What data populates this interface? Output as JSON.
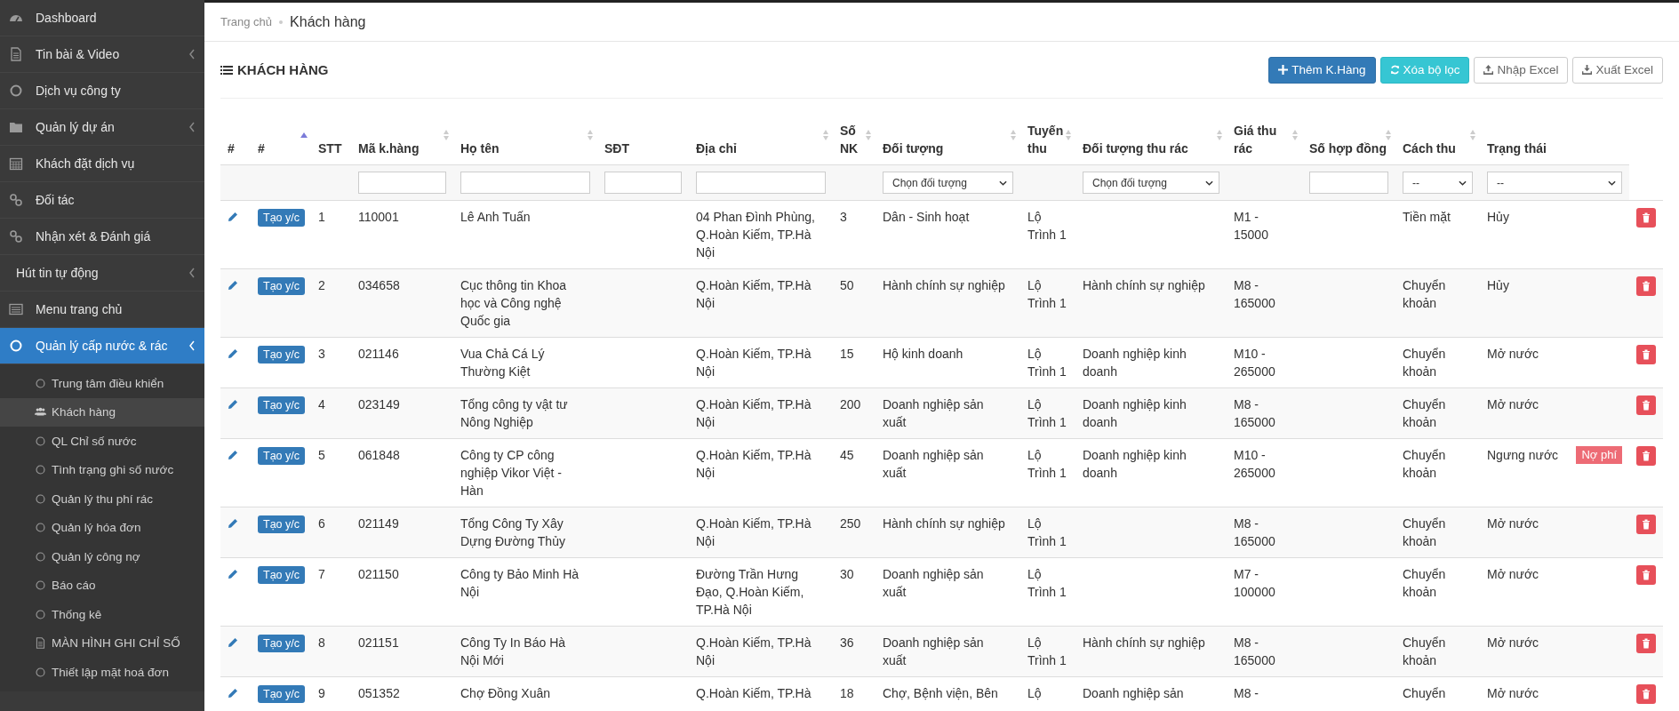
{
  "sidebar": {
    "items": [
      {
        "label": "Dashboard",
        "selected": false,
        "has_submenu": false
      },
      {
        "label": "Tin bài & Video",
        "selected": false,
        "has_submenu": true
      },
      {
        "label": "Dịch vụ công ty",
        "selected": false,
        "has_submenu": false
      },
      {
        "label": "Quản lý dự án",
        "selected": false,
        "has_submenu": true
      },
      {
        "label": "Khách đặt dịch vụ",
        "selected": false,
        "has_submenu": false
      },
      {
        "label": "Đối tác",
        "selected": false,
        "has_submenu": false
      },
      {
        "label": "Nhận xét & Đánh giá",
        "selected": false,
        "has_submenu": false
      },
      {
        "label": "Hút tin tự động",
        "selected": false,
        "has_submenu": true
      },
      {
        "label": "Menu trang chủ",
        "selected": false,
        "has_submenu": false
      },
      {
        "label": "Quản lý cấp nước & rác",
        "selected": true,
        "has_submenu": true,
        "children": [
          {
            "label": "Trung tâm điều khiển",
            "selected": false
          },
          {
            "label": "Khách hàng",
            "selected": true
          },
          {
            "label": "QL Chỉ số nước",
            "selected": false
          },
          {
            "label": "Tình trạng ghi số nước",
            "selected": false
          },
          {
            "label": "Quản lý thu phí rác",
            "selected": false
          },
          {
            "label": "Quản lý hóa đơn",
            "selected": false
          },
          {
            "label": "Quản lý công nợ",
            "selected": false
          },
          {
            "label": "Báo cáo",
            "selected": false
          },
          {
            "label": "Thống kê",
            "selected": false
          },
          {
            "label": "MÀN HÌNH GHI CHỈ SỐ",
            "selected": false
          },
          {
            "label": "Thiết lập mặt hoá đơn",
            "selected": false
          }
        ]
      }
    ]
  },
  "breadcrumb": [
    "Trang chủ",
    "Khách hàng"
  ],
  "panel": {
    "title": "KHÁCH HÀNG",
    "buttons": [
      {
        "label": "Thêm K.Hàng",
        "kind": "primary"
      },
      {
        "label": "Xóa bộ lọc",
        "kind": "info"
      },
      {
        "label": "Nhập Excel",
        "kind": "upload"
      },
      {
        "label": "Xuất Excel",
        "kind": "download"
      }
    ]
  },
  "table": {
    "columns": [
      {
        "label": "#",
        "sortable": false,
        "sorted": false
      },
      {
        "label": "#",
        "sortable": true,
        "sorted": true
      },
      {
        "label": "STT",
        "sortable": false,
        "sorted": false
      },
      {
        "label": "Mã k.hàng",
        "sortable": true,
        "sorted": false,
        "filter": {
          "kind": "input"
        }
      },
      {
        "label": "Họ tên",
        "sortable": true,
        "sorted": false,
        "filter": {
          "kind": "input"
        }
      },
      {
        "label": "SĐT",
        "sortable": false,
        "sorted": false,
        "filter": {
          "kind": "input"
        }
      },
      {
        "label": "Địa chỉ",
        "sortable": true,
        "sorted": false,
        "filter": {
          "kind": "input"
        }
      },
      {
        "label": "Số NK",
        "sortable": true,
        "sorted": false
      },
      {
        "label": "Đối tượng",
        "sortable": true,
        "sorted": false,
        "filter": {
          "kind": "select",
          "value": "Chọn đối tượng"
        }
      },
      {
        "label": "Tuyến thu",
        "sortable": true,
        "sorted": false
      },
      {
        "label": "Đối tượng thu rác",
        "sortable": true,
        "sorted": false,
        "filter": {
          "kind": "select",
          "value": "Chọn đối tượng"
        }
      },
      {
        "label": "Giá thu rác",
        "sortable": true,
        "sorted": false
      },
      {
        "label": "Số hợp đồng",
        "sortable": true,
        "sorted": false,
        "filter": {
          "kind": "input"
        }
      },
      {
        "label": "Cách thu",
        "sortable": true,
        "sorted": false,
        "filter": {
          "kind": "select",
          "value": "--"
        }
      },
      {
        "label": "Trạng thái",
        "sortable": false,
        "sorted": false,
        "filter": {
          "kind": "select",
          "value": "--"
        }
      }
    ],
    "rows": [
      {
        "action": "Tạo y/c",
        "stt": "1",
        "code": "110001",
        "name": "Lê Anh Tuấn",
        "address": "04 Phan Đình Phùng, Q.Hoàn Kiếm, TP.Hà Nội",
        "nk": "3",
        "target": "Dân - Sinh hoạt",
        "route": "Lộ Trình 1",
        "waste_target": "",
        "price": "M1 - 15000",
        "method": "Tiền mặt",
        "status": "Hủy"
      },
      {
        "action": "Tạo y/c",
        "stt": "2",
        "code": "034658",
        "name": "Cục thông tin Khoa học và Công nghệ Quốc gia",
        "address": "Q.Hoàn Kiếm, TP.Hà Nội",
        "nk": "50",
        "target": "Hành chính sự nghiệp",
        "route": "Lộ Trình 1",
        "waste_target": "Hành chính sự nghiệp",
        "price": "M8 - 165000",
        "method": "Chuyển khoản",
        "status": "Hủy"
      },
      {
        "action": "Tạo y/c",
        "stt": "3",
        "code": "021146",
        "name": "Vua Chả Cá Lý Thường Kiệt",
        "address": "Q.Hoàn Kiếm, TP.Hà Nội",
        "nk": "15",
        "target": "Hộ kinh doanh",
        "route": "Lộ Trình 1",
        "waste_target": "Doanh nghiệp kinh doanh",
        "price": "M10 - 265000",
        "method": "Chuyển khoản",
        "status": "Mở nước"
      },
      {
        "action": "Tạo y/c",
        "stt": "4",
        "code": "023149",
        "name": "Tổng công ty vật tư Nông Nghiệp",
        "address": "Q.Hoàn Kiếm, TP.Hà Nội",
        "nk": "200",
        "target": "Doanh nghiệp sản xuất",
        "route": "Lộ Trình 1",
        "waste_target": "Doanh nghiệp kinh doanh",
        "price": "M8 - 165000",
        "method": "Chuyển khoản",
        "status": "Mở nước"
      },
      {
        "action": "Tạo y/c",
        "stt": "5",
        "code": "061848",
        "name": "Công ty CP công nghiệp Vikor Việt - Hàn",
        "address": "Q.Hoàn Kiếm, TP.Hà Nội",
        "nk": "45",
        "target": "Doanh nghiệp sản xuất",
        "route": "Lộ Trình 1",
        "waste_target": "Doanh nghiệp kinh doanh",
        "price": "M10 - 265000",
        "method": "Chuyển khoản",
        "status": "Ngưng nước",
        "badge": "Nợ phí"
      },
      {
        "action": "Tạo y/c",
        "stt": "6",
        "code": "021149",
        "name": "Tổng Công Ty Xây Dựng Đường Thủy",
        "address": "Q.Hoàn Kiếm, TP.Hà Nội",
        "nk": "250",
        "target": "Hành chính sự nghiệp",
        "route": "Lộ Trình 1",
        "waste_target": "",
        "price": "M8 - 165000",
        "method": "Chuyển khoản",
        "status": "Mở nước"
      },
      {
        "action": "Tạo y/c",
        "stt": "7",
        "code": "021150",
        "name": "Công ty Bảo Minh Hà Nội",
        "address": "Đường Trần Hưng Đạo, Q.Hoàn Kiếm, TP.Hà Nội",
        "nk": "30",
        "target": "Doanh nghiệp sản xuất",
        "route": "Lộ Trình 1",
        "waste_target": "",
        "price": "M7 - 100000",
        "method": "Chuyển khoản",
        "status": "Mở nước"
      },
      {
        "action": "Tạo y/c",
        "stt": "8",
        "code": "021151",
        "name": "Công Ty In Báo Hà Nội Mới",
        "address": "Q.Hoàn Kiếm, TP.Hà Nội",
        "nk": "36",
        "target": "Doanh nghiệp sản xuất",
        "route": "Lộ Trình 1",
        "waste_target": "Hành chính sự nghiệp",
        "price": "M8 - 165000",
        "method": "Chuyển khoản",
        "status": "Mở nước"
      },
      {
        "action": "Tạo y/c",
        "stt": "9",
        "code": "051352",
        "name": "Chợ Đồng Xuân",
        "address": "Q.Hoàn Kiếm, TP.Hà",
        "nk": "18",
        "target": "Chợ, Bệnh viện, Bên",
        "route": "Lộ",
        "waste_target": "Doanh nghiệp sản",
        "price": "M8 -",
        "method": "Chuyển",
        "status": "Mở nước"
      }
    ]
  }
}
